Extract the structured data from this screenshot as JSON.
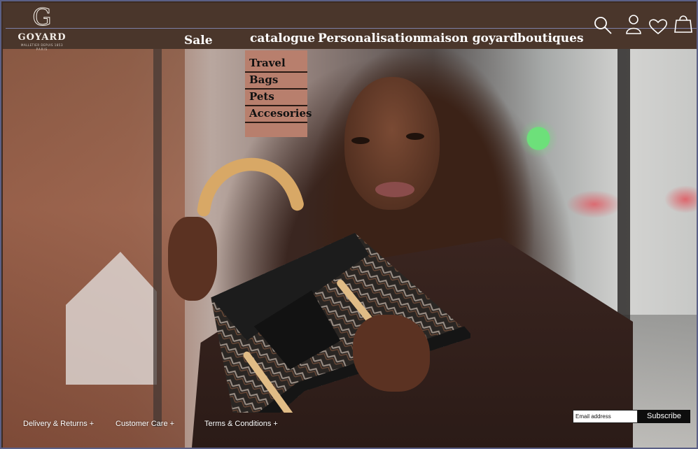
{
  "brand": {
    "logo_letter": "G",
    "name": "GOYARD",
    "tagline": "MALLETIER DEPUIS 1853",
    "city": "PARIS"
  },
  "nav": {
    "items": [
      {
        "label": "Sale"
      },
      {
        "label": "catalogue"
      },
      {
        "label": "Personalisation"
      },
      {
        "label": "maison goyard"
      },
      {
        "label": "boutiques"
      }
    ]
  },
  "header_icons": [
    "search-icon",
    "account-icon",
    "wishlist-heart-icon",
    "shopping-bag-icon"
  ],
  "catalogue_menu": {
    "items": [
      {
        "label": "Travel"
      },
      {
        "label": "Bags"
      },
      {
        "label": "Pets"
      },
      {
        "label": "Accesories"
      }
    ]
  },
  "footer": {
    "links": [
      {
        "label": "Delivery & Returns +"
      },
      {
        "label": "Customer Care +"
      },
      {
        "label": "Terms & Conditions +"
      }
    ],
    "newsletter": {
      "placeholder": "Email address",
      "button_label": "Subscribe"
    }
  },
  "colors": {
    "header_bg": "#4a362b",
    "dropdown_bg": "#b87f6d",
    "button_bg": "#0d0d0d"
  }
}
